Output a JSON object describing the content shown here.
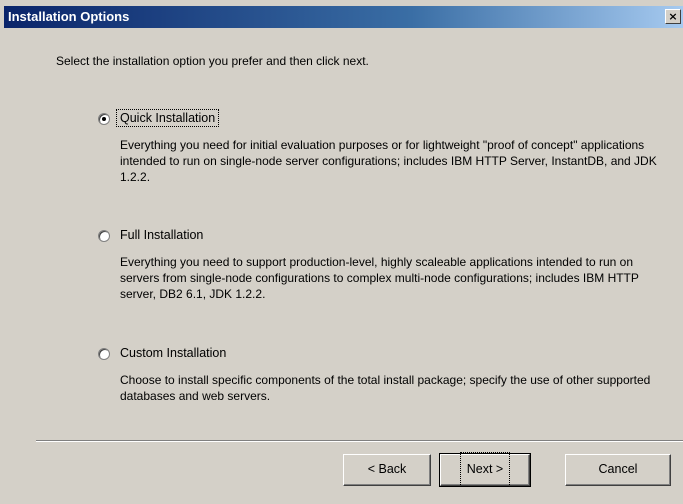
{
  "window": {
    "title": "Installation Options",
    "close_glyph": "×"
  },
  "instruction": "Select the installation option you prefer and then click next.",
  "options": [
    {
      "label": "Quick Installation",
      "selected": true,
      "description": "Everything you need for initial evaluation purposes or for lightweight \"proof of concept\" applications intended to run on single-node server configurations; includes IBM HTTP Server, InstantDB, and JDK 1.2.2."
    },
    {
      "label": "Full Installation",
      "selected": false,
      "description": "Everything you need to support production-level, highly scaleable applications intended to run on servers from single-node configurations to complex multi-node configurations; includes IBM HTTP server, DB2 6.1, JDK 1.2.2."
    },
    {
      "label": "Custom Installation",
      "selected": false,
      "description": "Choose to install specific components of the total install package; specify the use of other supported databases and web servers."
    }
  ],
  "buttons": {
    "back": "< Back",
    "next": "Next >",
    "cancel": "Cancel"
  },
  "colors": {
    "titlebar_start": "#0a246a",
    "titlebar_end": "#a6caf0",
    "face": "#d4d0c8"
  }
}
